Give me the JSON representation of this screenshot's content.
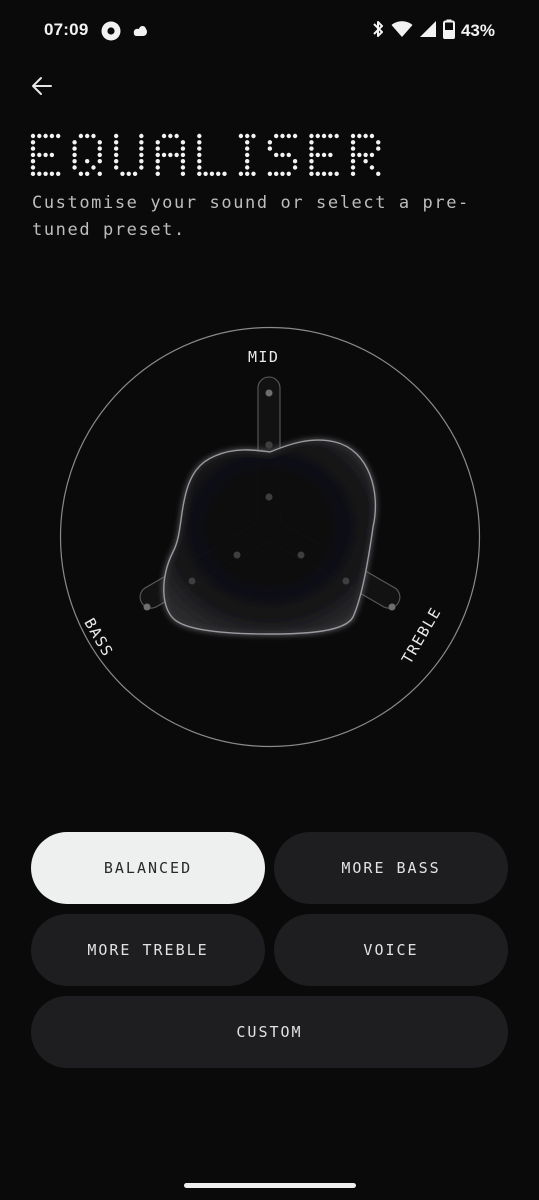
{
  "status_bar": {
    "time": "07:09",
    "battery_percent": "43%",
    "icons": [
      "record-icon",
      "notification-blob-icon",
      "bluetooth-icon",
      "wifi-icon",
      "signal-icon",
      "battery-icon"
    ]
  },
  "header": {
    "back_icon": "arrow-left-icon",
    "title": "EQUALISER",
    "subtitle": "Customise your sound or select a pre-tuned preset."
  },
  "equaliser": {
    "labels": {
      "mid": "MID",
      "bass": "BASS",
      "treble": "TREBLE"
    }
  },
  "presets": {
    "balanced": "BALANCED",
    "more_bass": "MORE BASS",
    "more_treble": "MORE TREBLE",
    "voice": "VOICE",
    "custom": "CUSTOM",
    "selected": "BALANCED"
  },
  "colors": {
    "background": "#0a0a0b",
    "button": "#1e1e20",
    "selected_button": "#eef0ef",
    "text": "#e9e9e9"
  }
}
